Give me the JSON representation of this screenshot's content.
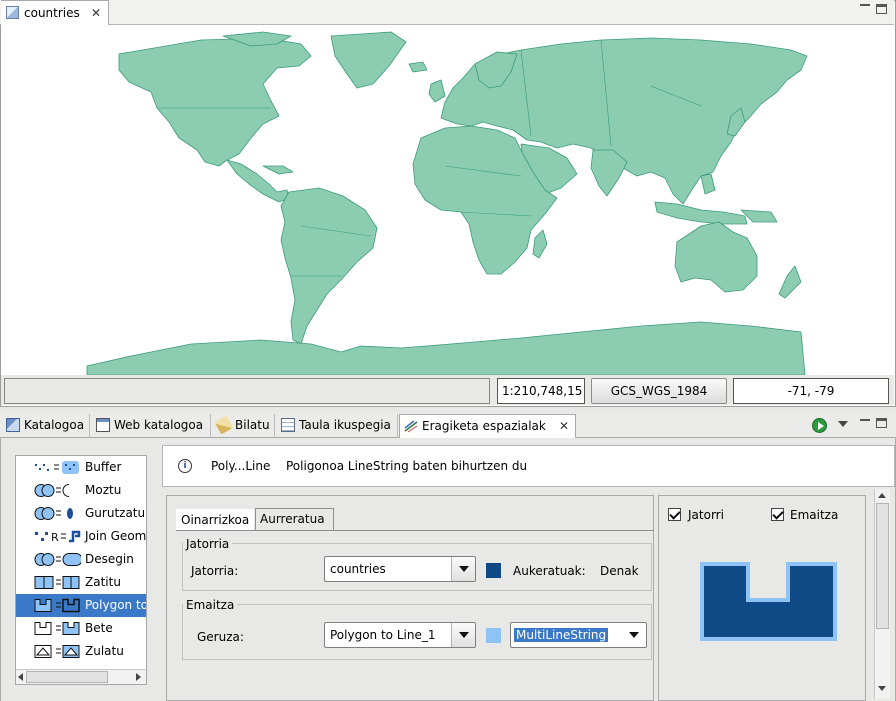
{
  "map_view": {
    "tab_label": "countries",
    "colors": {
      "land": "#8ccdb2",
      "border": "#3b9a7c",
      "background": "#ffffff"
    }
  },
  "statusbar": {
    "scale": "1:210,748,15",
    "crs": "GCS_WGS_1984",
    "coordinates": "-71, -79"
  },
  "bottom_tabs": [
    {
      "label": "Katalogoa",
      "icon": "catalog-icon"
    },
    {
      "label": "Web katalogoa",
      "icon": "web-catalog-icon"
    },
    {
      "label": "Bilatu",
      "icon": "search-icon"
    },
    {
      "label": "Taula ikuspegia",
      "icon": "table-icon"
    },
    {
      "label": "Eragiketa espazialak",
      "icon": "spatial-ops-icon",
      "active": true
    }
  ],
  "tools": [
    {
      "label": "Buffer",
      "icon": "buffer-icon"
    },
    {
      "label": "Moztu",
      "icon": "clip-icon"
    },
    {
      "label": "Gurutzatu",
      "icon": "intersect-icon"
    },
    {
      "label": "Join Geom",
      "icon": "join-geometry-icon"
    },
    {
      "label": "Desegin",
      "icon": "dissolve-icon"
    },
    {
      "label": "Zatitu",
      "icon": "split-icon"
    },
    {
      "label": "Polygon to",
      "icon": "polygon-to-line-icon",
      "selected": true
    },
    {
      "label": "Bete",
      "icon": "fill-icon"
    },
    {
      "label": "Zulatu",
      "icon": "hole-icon"
    }
  ],
  "info": {
    "title": "Poly...Line",
    "description": "Poligonoa LineString baten bihurtzen du"
  },
  "params": {
    "tabs": [
      "Oinarrizkoa",
      "Aurreratua"
    ],
    "source_group": {
      "title": "Jatorria",
      "label": "Jatorria:",
      "value": "countries",
      "swatch_color": "#0f4a86",
      "selected_label": "Aukeratuak:",
      "selected_value": "Denak"
    },
    "result_group": {
      "title": "Emaitza",
      "label": "Geruza:",
      "layer_value": "Polygon to Line_1",
      "swatch_color": "#8fc3f5",
      "geometry_value": "MultiLineString"
    }
  },
  "preview": {
    "source_label": "Jatorri",
    "result_label": "Emaitza",
    "source_color": "#0f4a86",
    "result_color": "#8fc3f5"
  }
}
